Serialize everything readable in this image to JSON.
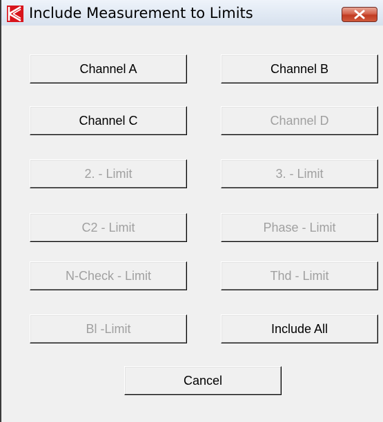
{
  "window": {
    "title": "Include Measurement to Limits"
  },
  "buttons": {
    "channel_a": "Channel A",
    "channel_b": "Channel B",
    "channel_c": "Channel C",
    "channel_d": "Channel D",
    "limit_2": "2. - Limit",
    "limit_3": "3. - Limit",
    "c2_limit": "C2 - Limit",
    "phase_limit": "Phase - Limit",
    "ncheck_limit": "N-Check - Limit",
    "thd_limit": "Thd - Limit",
    "bl_limit": "Bl -Limit",
    "include_all": "Include All",
    "cancel": "Cancel"
  },
  "colors": {
    "enabled_text": "#000000",
    "disabled_text": "#a0a0a0",
    "app_icon_red": "#d8141c",
    "close_button_red": "#c13b22"
  }
}
